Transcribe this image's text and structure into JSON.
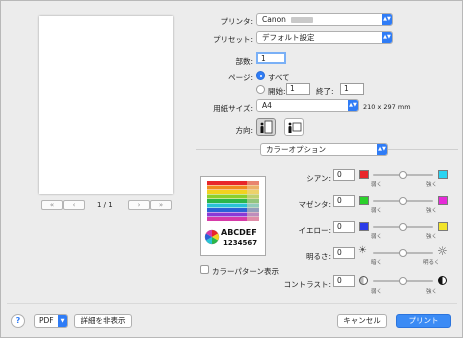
{
  "preview": {
    "page_indicator": "1 / 1",
    "first_page": "«",
    "prev_page": "‹",
    "next_page": "›",
    "last_page": "»"
  },
  "printer": {
    "label": "プリンタ:",
    "value": "Canon"
  },
  "presets": {
    "label": "プリセット:",
    "value": "デフォルト設定"
  },
  "copies": {
    "label": "部数:",
    "value": "1"
  },
  "pages": {
    "label": "ページ:",
    "all_label": "すべて",
    "from_label": "開始:",
    "from_value": "1",
    "to_label": "終了:",
    "to_value": "1"
  },
  "paper_size": {
    "label": "用紙サイズ:",
    "value": "A4",
    "dimensions": "210 x 297 mm"
  },
  "orientation": {
    "label": "方向:"
  },
  "section": {
    "value": "カラーオプション"
  },
  "pattern": {
    "text_line1": "ABCDEF",
    "text_line2": "1234567",
    "checkbox_label": "カラーパターン表示"
  },
  "color": {
    "cyan_label": "シアン:",
    "cyan_value": "0",
    "magenta_label": "マゼンタ:",
    "magenta_value": "0",
    "yellow_label": "イエロー:",
    "yellow_value": "0",
    "brightness_label": "明るさ:",
    "brightness_value": "0",
    "contrast_label": "コントラスト:",
    "contrast_value": "0",
    "weak": "弱く",
    "strong": "強く",
    "dark": "暗く",
    "bright": "明るく",
    "colors": {
      "red": "#e8262b",
      "cyan": "#2ad4f2",
      "green": "#2bd12b",
      "magenta": "#e62ad8",
      "blue": "#2a3be8",
      "yellow": "#f2e42a"
    }
  },
  "footer": {
    "help": "?",
    "pdf": "PDF",
    "hide_details": "詳細を非表示",
    "cancel": "キャンセル",
    "print": "プリント"
  }
}
